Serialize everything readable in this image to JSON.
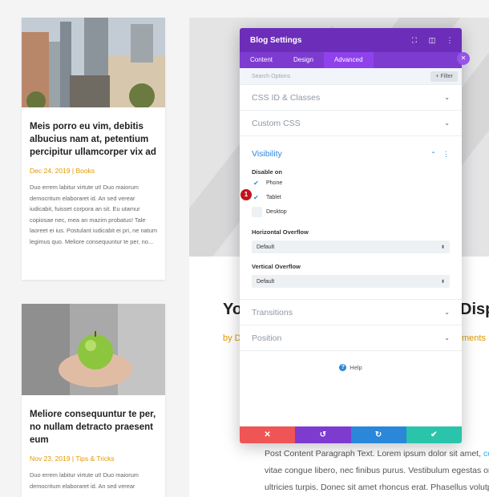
{
  "blog_cards": [
    {
      "title": "Meis porro eu vim, debitis albucius nam at, petentium percipitur ullamcorper vix ad",
      "meta": "Dec 24, 2019 | Books",
      "excerpt": "Duo errem labitur virtute ut! Duo maiorum democritum elaboraret id. An sed verear iudicabit, fuisset corpora an sit. Eu utamur copiosae nec, mea an mazim probatus! Tale laoreet ei ius. Postulant iudicabit ei pri, ne natum legimus quo. Meliore consequuntur te per, no..."
    },
    {
      "title": "Meliore consequuntur te per, no nullam detracto praesent eum",
      "meta": "Nov 23, 2019 | Tips & Tricks",
      "excerpt": "Duo errem labitur virtute ut! Duo maiorum democritum elaboraret id. An sed verear"
    }
  ],
  "post": {
    "title_left": "Yo",
    "title_right": "Disp",
    "meta_left": "by D",
    "meta_right": "ments",
    "paragraph_lines": [
      "Post Content Paragraph Text. Lorem ipsum dolor sit amet,",
      "vitae congue libero, nec finibus purus. Vestibulum egestas orci",
      "ultricies turpis. Donec sit amet rhoncus erat. Phasellus volutpa"
    ],
    "paragraph_link": "con"
  },
  "modal": {
    "title": "Blog Settings",
    "header_icons": [
      "expand-icon",
      "columns-icon",
      "more-icon"
    ],
    "tabs": [
      "Content",
      "Design",
      "Advanced"
    ],
    "active_tab": "Advanced",
    "search_placeholder": "Search Options",
    "filter_label": "+ Filter",
    "sections": {
      "css_id": "CSS ID & Classes",
      "custom_css": "Custom CSS",
      "visibility": "Visibility",
      "transitions": "Transitions",
      "position": "Position"
    },
    "visibility": {
      "disable_on_label": "Disable on",
      "options": [
        {
          "label": "Phone",
          "checked": true
        },
        {
          "label": "Tablet",
          "checked": true
        },
        {
          "label": "Desktop",
          "checked": false
        }
      ],
      "badge_number": "1",
      "horizontal_overflow_label": "Horizontal Overflow",
      "horizontal_overflow_value": "Default",
      "vertical_overflow_label": "Vertical Overflow",
      "vertical_overflow_value": "Default"
    },
    "help_label": "Help",
    "footer_buttons": [
      "cancel",
      "undo",
      "redo",
      "save"
    ],
    "colors": {
      "header": "#6c2eb9",
      "tabs": "#7e3bd0",
      "accent_blue": "#2b87da",
      "cancel": "#ef5555",
      "save": "#29c4a9"
    }
  },
  "colors": {
    "meta_orange": "#e09900",
    "badge_red": "#c0141c"
  }
}
